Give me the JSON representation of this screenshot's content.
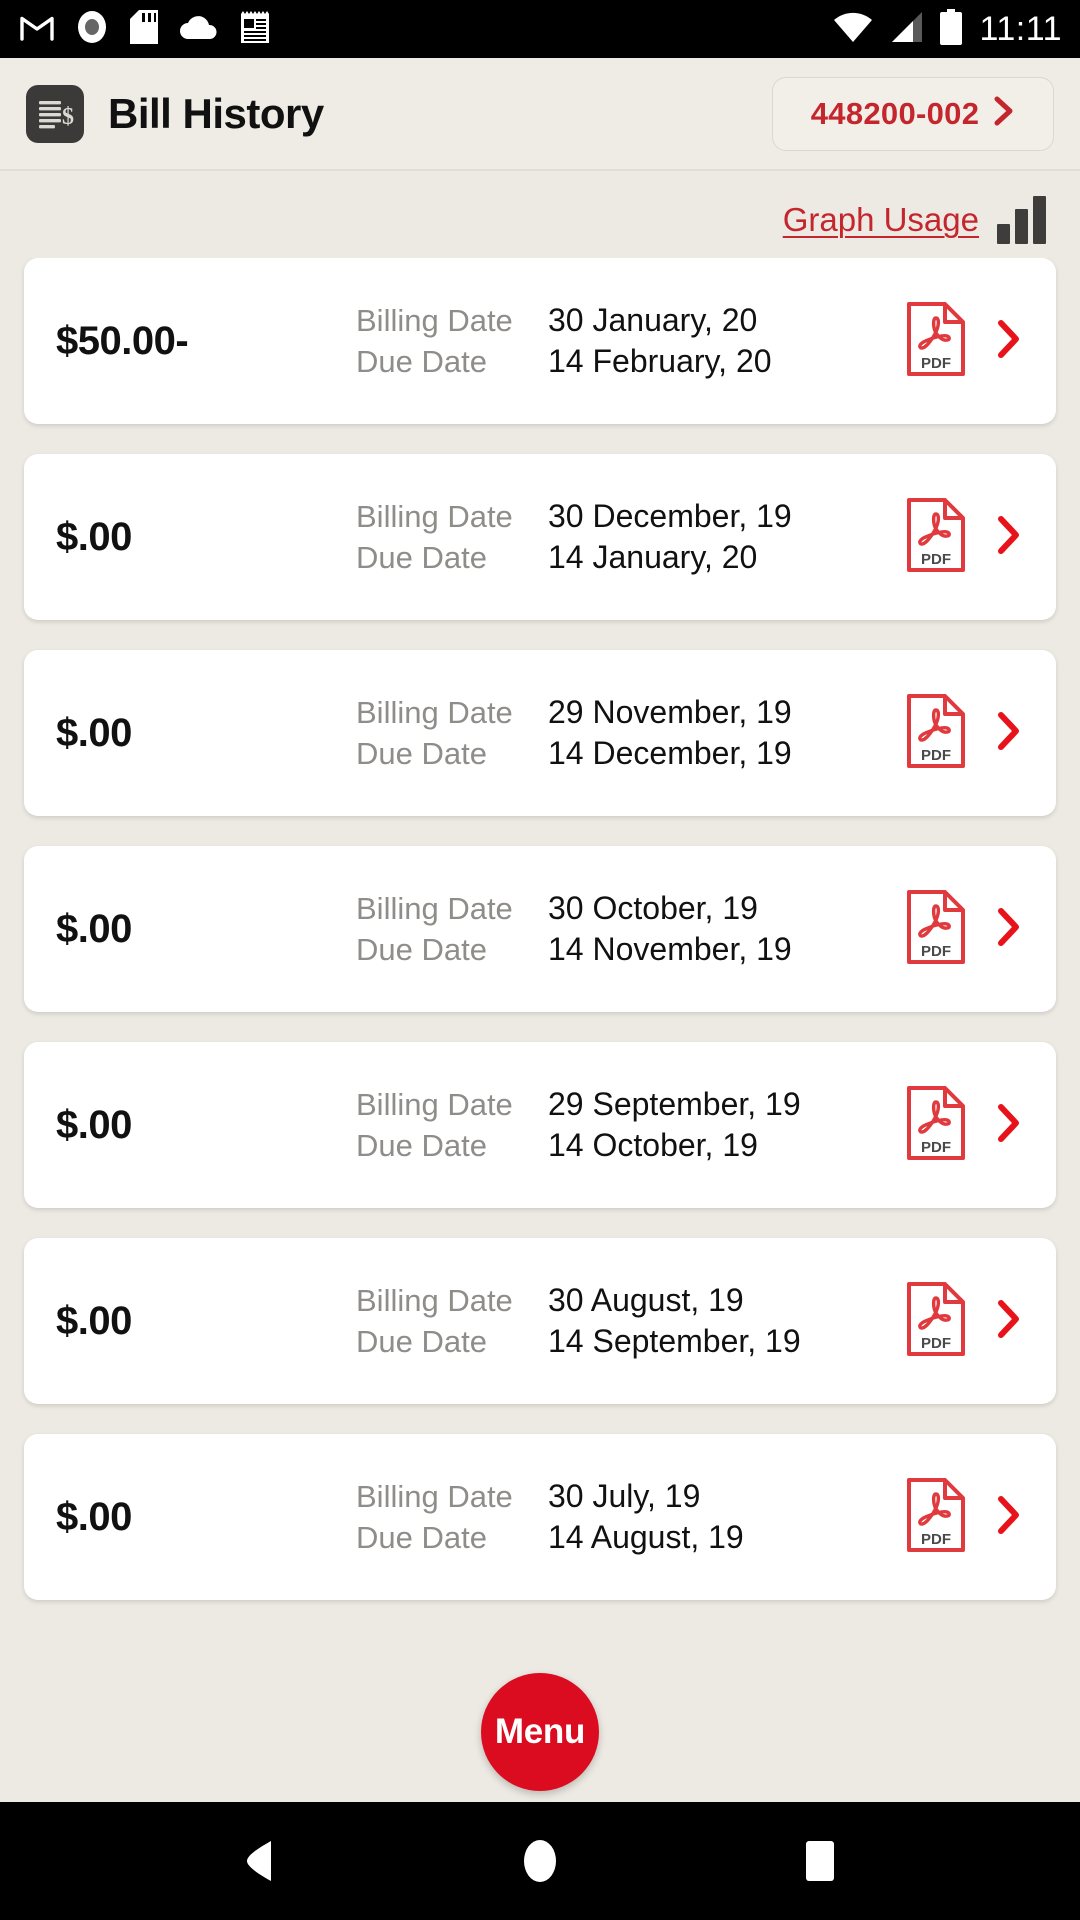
{
  "statusbar": {
    "time": "11:11",
    "left_icons": [
      "gmail-icon",
      "record-icon",
      "sd-card-icon",
      "cloud-icon",
      "news-icon"
    ],
    "right_icons": [
      "wifi-icon",
      "cell-signal-icon",
      "battery-icon"
    ]
  },
  "header": {
    "icon": "bill-document-icon",
    "title": "Bill History",
    "account_button": {
      "number": "448200-002",
      "chevron": "chevron-right-icon"
    }
  },
  "usage": {
    "link_label": "Graph Usage",
    "chart_icon": "bar-chart-icon"
  },
  "labels": {
    "billing_date": "Billing Date",
    "due_date": "Due Date",
    "pdf": "PDF"
  },
  "bills": [
    {
      "amount": "$50.00-",
      "billing_date": "30 January, 20",
      "due_date": "14 February, 20"
    },
    {
      "amount": "$.00",
      "billing_date": "30 December, 19",
      "due_date": "14 January, 20"
    },
    {
      "amount": "$.00",
      "billing_date": "29 November, 19",
      "due_date": "14 December, 19"
    },
    {
      "amount": "$.00",
      "billing_date": "30 October, 19",
      "due_date": "14 November, 19"
    },
    {
      "amount": "$.00",
      "billing_date": "29 September, 19",
      "due_date": "14 October, 19"
    },
    {
      "amount": "$.00",
      "billing_date": "30 August, 19",
      "due_date": "14 September, 19"
    },
    {
      "amount": "$.00",
      "billing_date": "30 July, 19",
      "due_date": "14 August, 19"
    }
  ],
  "fab": {
    "label": "Menu"
  },
  "navbar": {
    "back": "back-triangle-icon",
    "home": "home-circle-icon",
    "recents": "recents-square-icon"
  },
  "colors": {
    "brand_red": "#c4262e",
    "fab_red": "#dc0c20",
    "page_bg": "#ede9e3",
    "header_bg": "#efebe5",
    "card_bg": "#ffffff",
    "muted_text": "#8f8d8a",
    "icon_dark": "#3c3a38"
  }
}
